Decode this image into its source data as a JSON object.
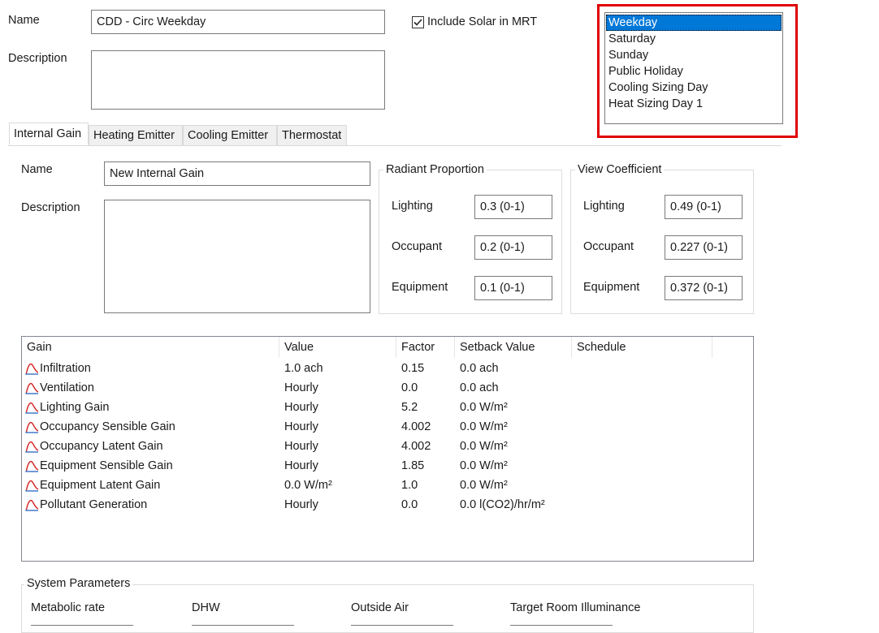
{
  "header": {
    "name_label": "Name",
    "name_value": "CDD - Circ Weekday",
    "description_label": "Description",
    "description_value": "",
    "solar_checkbox_label": "Include Solar in MRT",
    "solar_checked": true
  },
  "day_list": {
    "items": [
      "Weekday",
      "Saturday",
      "Sunday",
      "Public Holiday",
      "Cooling Sizing Day",
      "Heat Sizing Day 1"
    ],
    "selected": "Weekday",
    "highlight_color": "#e00000"
  },
  "tabs": [
    "Internal Gain",
    "Heating Emitter",
    "Cooling Emitter",
    "Thermostat"
  ],
  "gain": {
    "name_label": "Name",
    "name_value": "New Internal Gain",
    "description_label": "Description",
    "description_value": ""
  },
  "radiant": {
    "title": "Radiant Proportion",
    "lighting_label": "Lighting",
    "lighting_value": "0.3 (0-1)",
    "occupant_label": "Occupant",
    "occupant_value": "0.2 (0-1)",
    "equipment_label": "Equipment",
    "equipment_value": "0.1 (0-1)"
  },
  "view": {
    "title": "View Coefficient",
    "lighting_label": "Lighting",
    "lighting_value": "0.49 (0-1)",
    "occupant_label": "Occupant",
    "occupant_value": "0.227 (0-1)",
    "equipment_label": "Equipment",
    "equipment_value": "0.372 (0-1)"
  },
  "table": {
    "headers": [
      "Gain",
      "Value",
      "Factor",
      "Setback Value",
      "Schedule"
    ],
    "rows": [
      {
        "gain": "Infiltration",
        "value": "1.0 ach",
        "factor": "0.15",
        "setback": "0.0 ach",
        "schedule": ""
      },
      {
        "gain": "Ventilation",
        "value": "Hourly",
        "factor": "0.0",
        "setback": "0.0 ach",
        "schedule": ""
      },
      {
        "gain": "Lighting Gain",
        "value": "Hourly",
        "factor": "5.2",
        "setback": "0.0 W/m²",
        "schedule": ""
      },
      {
        "gain": "Occupancy Sensible Gain",
        "value": "Hourly",
        "factor": "4.002",
        "setback": "0.0 W/m²",
        "schedule": ""
      },
      {
        "gain": "Occupancy Latent Gain",
        "value": "Hourly",
        "factor": "4.002",
        "setback": "0.0 W/m²",
        "schedule": ""
      },
      {
        "gain": "Equipment Sensible Gain",
        "value": "Hourly",
        "factor": "1.85",
        "setback": "0.0 W/m²",
        "schedule": ""
      },
      {
        "gain": "Equipment Latent Gain",
        "value": "0.0 W/m²",
        "factor": "1.0",
        "setback": "0.0 W/m²",
        "schedule": ""
      },
      {
        "gain": "Pollutant Generation",
        "value": "Hourly",
        "factor": "0.0",
        "setback": "0.0 l(CO2)/hr/m²",
        "schedule": ""
      }
    ],
    "row_icon": "schedule-curve-icon"
  },
  "system": {
    "title": "System Parameters",
    "metabolic_label": "Metabolic rate",
    "dhw_label": "DHW",
    "outside_air_label": "Outside Air",
    "illuminance_label": "Target Room Illuminance"
  }
}
